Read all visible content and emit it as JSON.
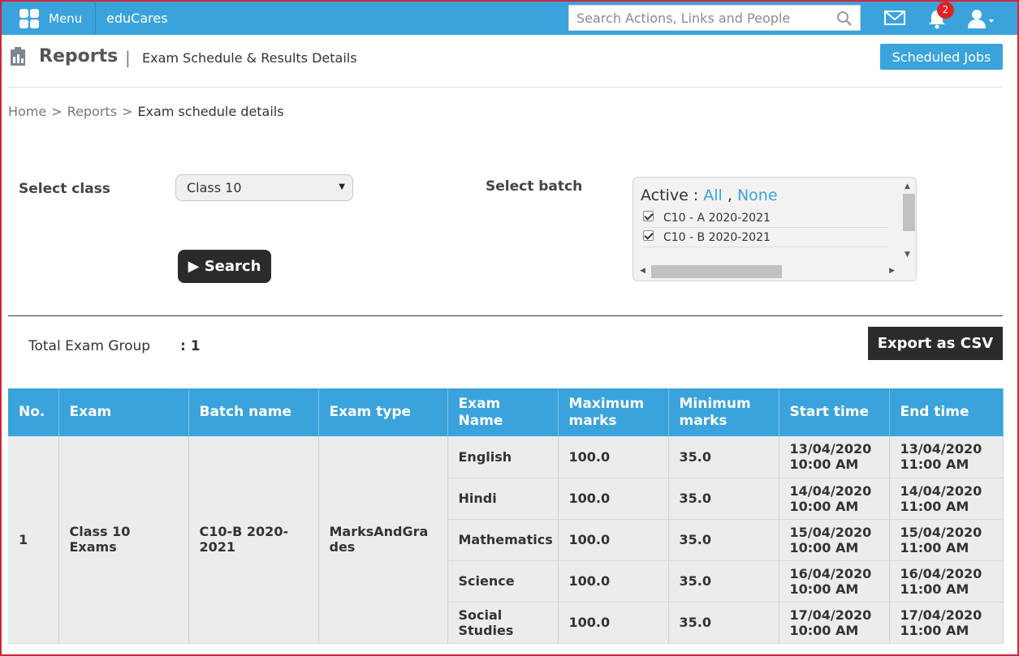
{
  "topbar": {
    "menu_label": "Menu",
    "brand": "eduCares",
    "search_placeholder": "Search Actions, Links and People",
    "notification_count": "2"
  },
  "header": {
    "title": "Reports",
    "separator": "|",
    "subtitle": "Exam Schedule & Results Details",
    "scheduled_jobs_label": "Scheduled Jobs"
  },
  "breadcrumb": {
    "home": "Home",
    "reports": "Reports",
    "current": "Exam schedule details",
    "separator": ">"
  },
  "filters": {
    "class_label": "Select class",
    "class_value": "Class 10",
    "batch_label": "Select batch",
    "batch_active_label": "Active :",
    "batch_all": "All",
    "batch_comma": ",",
    "batch_none": "None",
    "batches": [
      "C10 - A 2020-2021",
      "C10 - B 2020-2021"
    ],
    "search_label": "Search"
  },
  "summary": {
    "total_label": "Total Exam Group",
    "total_value": ": 1",
    "export_label": "Export as CSV"
  },
  "table": {
    "headers": [
      "No.",
      "Exam",
      "Batch name",
      "Exam type",
      "Exam Name",
      "Maximum marks",
      "Minimum marks",
      "Start time",
      "End time"
    ],
    "group": {
      "no": "1",
      "exam": "Class 10 Exams",
      "batch": "C10-B 2020-2021",
      "type": "MarksAndGrades"
    },
    "rows": [
      {
        "name": "English",
        "max": "100.0",
        "min": "35.0",
        "start": "13/04/2020 10:00 AM",
        "end": "13/04/2020 11:00 AM"
      },
      {
        "name": "Hindi",
        "max": "100.0",
        "min": "35.0",
        "start": "14/04/2020 10:00 AM",
        "end": "14/04/2020 11:00 AM"
      },
      {
        "name": "Mathematics",
        "max": "100.0",
        "min": "35.0",
        "start": "15/04/2020 10:00 AM",
        "end": "15/04/2020 11:00 AM"
      },
      {
        "name": "Science",
        "max": "100.0",
        "min": "35.0",
        "start": "16/04/2020 10:00 AM",
        "end": "16/04/2020 11:00 AM"
      },
      {
        "name": "Social Studies",
        "max": "100.0",
        "min": "35.0",
        "start": "17/04/2020 10:00 AM",
        "end": "17/04/2020 11:00 AM"
      }
    ]
  },
  "colors": {
    "accent": "#3aa3dc",
    "dark_button": "#2b2b2b",
    "badge": "#e52020",
    "frame": "#d0263a"
  }
}
